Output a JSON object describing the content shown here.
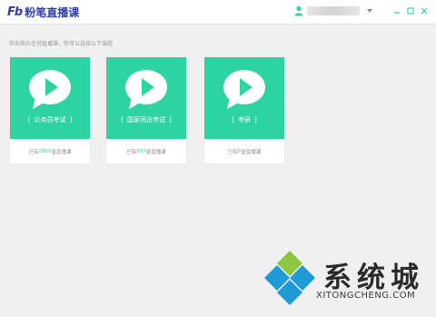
{
  "app": {
    "logo_mark": "Fb",
    "title": "粉笔直播课"
  },
  "titlebar": {
    "user_icon": "user-icon",
    "dropdown_icon": "chevron-down-icon",
    "controls": [
      "minimize-icon",
      "maximize-icon",
      "close-icon"
    ]
  },
  "hint": "你未购买任何直播课，你可以选择以下课程",
  "courses": [
    {
      "name": "公务员考试",
      "count_prefix": "已有",
      "count": "2805",
      "count_suffix": "堂直播课"
    },
    {
      "name": "国家司法考试",
      "count_prefix": "已有",
      "count": "107",
      "count_suffix": "堂直播课"
    },
    {
      "name": "考研",
      "count_prefix": "已有",
      "count": "5",
      "count_suffix": "堂直播课"
    }
  ],
  "bracket_open": "[",
  "bracket_close": "]",
  "watermark": {
    "title": "系统城",
    "url": "XITONGCHENG.COM"
  },
  "colors": {
    "accent": "#2ed3a3",
    "brand": "#2f3da8"
  }
}
